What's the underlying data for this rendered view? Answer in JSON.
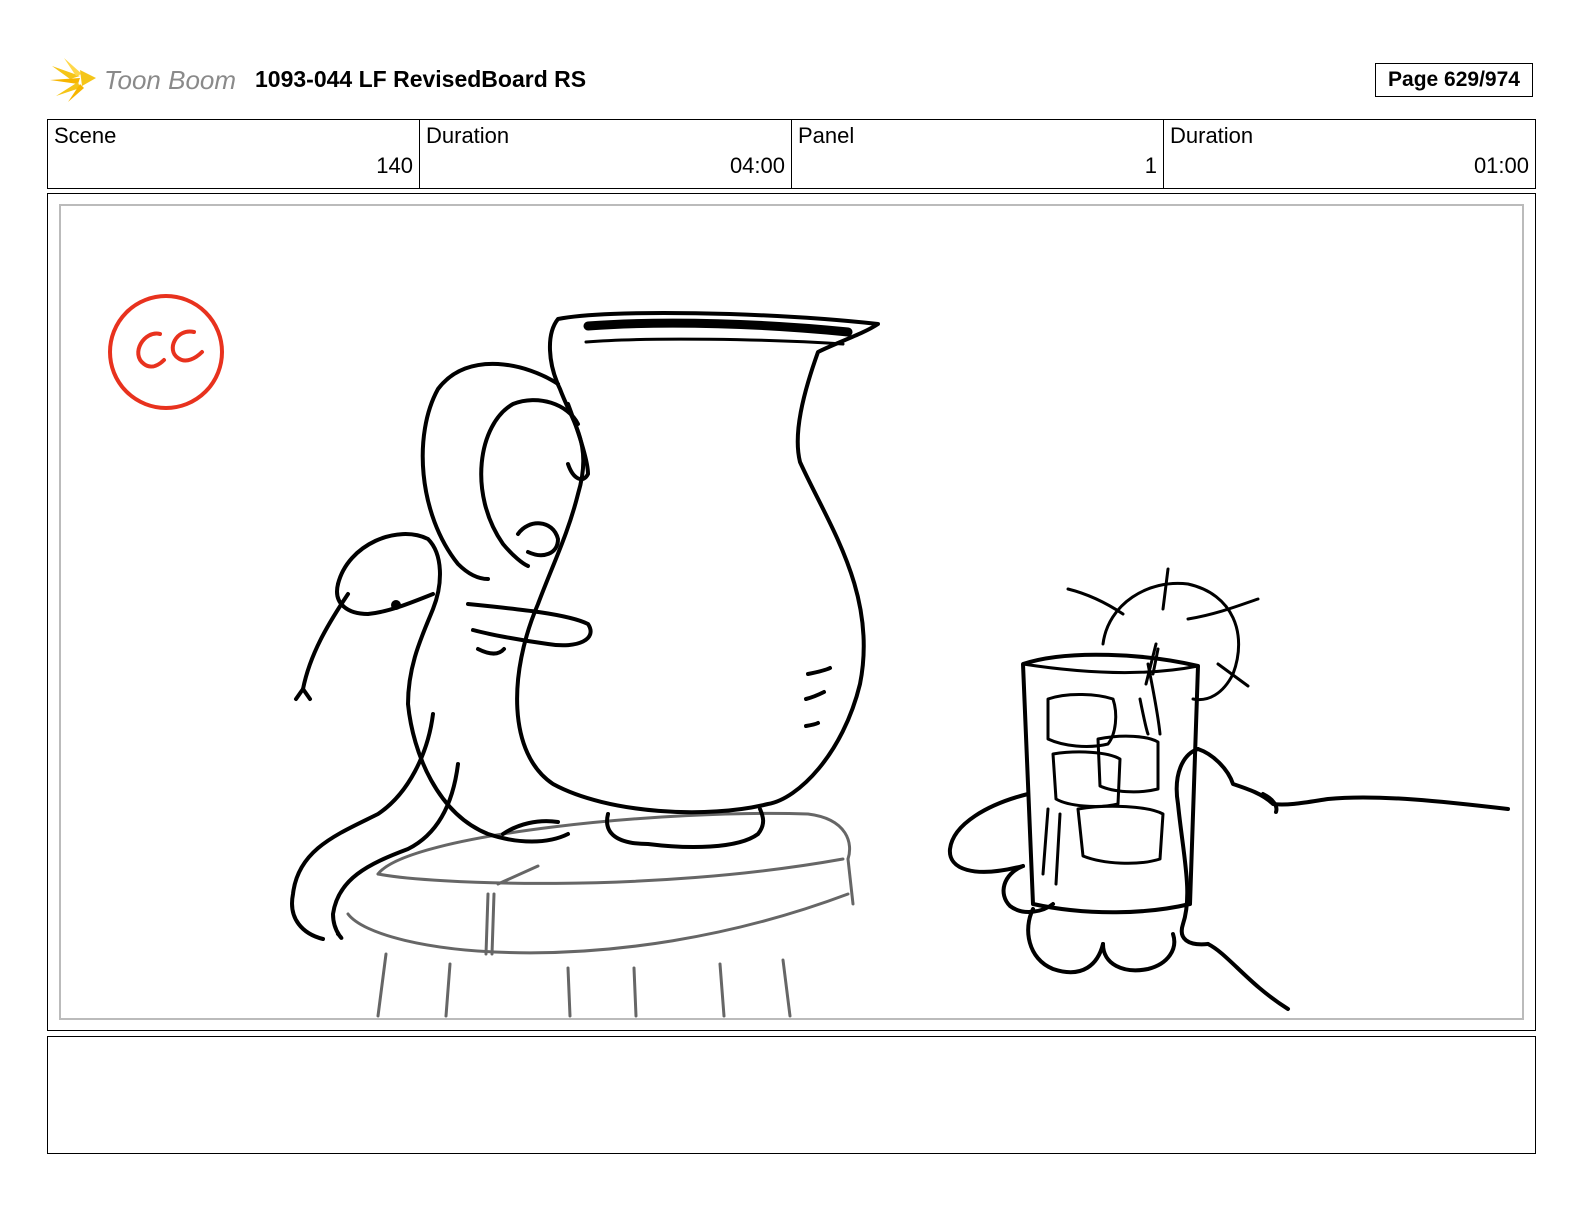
{
  "header": {
    "logo_text": "Toon Boom",
    "title": "1093-044 LF RevisedBoard RS",
    "page_label": "Page 629/974"
  },
  "info": {
    "scene_label": "Scene",
    "scene_value": "140",
    "scene_duration_label": "Duration",
    "scene_duration_value": "04:00",
    "panel_label": "Panel",
    "panel_value": "1",
    "panel_duration_label": "Duration",
    "panel_duration_value": "01:00"
  },
  "panel": {
    "stamp_text": "CC",
    "stamp_color": "#e8321e",
    "drawing": "pitcher-on-stool-and-hand-with-glass"
  },
  "notes": {
    "text": ""
  },
  "colors": {
    "logo_yellow": "#f5c518",
    "logo_gray": "#8a8a8a",
    "panel_border": "#bbbbbb"
  }
}
